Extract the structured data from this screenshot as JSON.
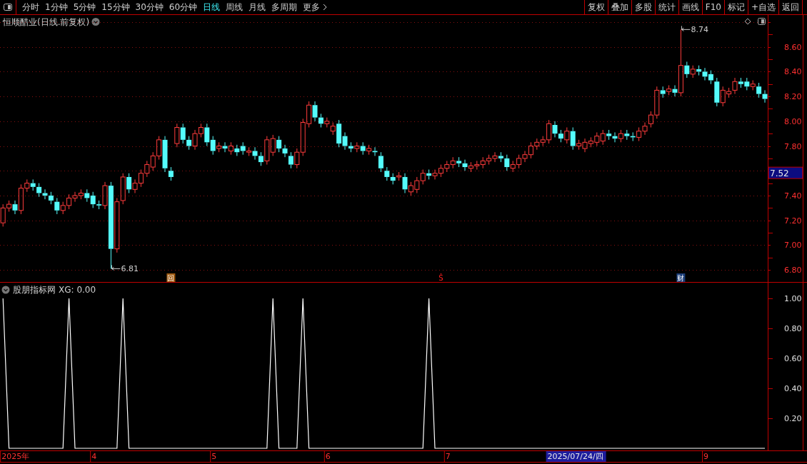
{
  "toolbar": {
    "periods": [
      {
        "label": "分时",
        "selected": false
      },
      {
        "label": "1分钟",
        "selected": false
      },
      {
        "label": "5分钟",
        "selected": false
      },
      {
        "label": "15分钟",
        "selected": false
      },
      {
        "label": "30分钟",
        "selected": false
      },
      {
        "label": "60分钟",
        "selected": false
      },
      {
        "label": "日线",
        "selected": true
      },
      {
        "label": "周线",
        "selected": false
      },
      {
        "label": "月线",
        "selected": false
      },
      {
        "label": "多周期",
        "selected": false
      },
      {
        "label": "更多",
        "selected": false
      }
    ],
    "buttons": [
      "复权",
      "叠加",
      "多股",
      "统计",
      "画线",
      "F10",
      "标记",
      "+自选",
      "返回"
    ]
  },
  "price_panel": {
    "title": "恒顺醋业(日线.前复权)",
    "chart_data": {
      "type": "candlestick",
      "ylim": [
        6.7,
        8.85
      ],
      "yticks": [
        {
          "value": 6.8,
          "label": "6.80"
        },
        {
          "value": 7.0,
          "label": "7.00"
        },
        {
          "value": 7.2,
          "label": "7.20"
        },
        {
          "value": 7.4,
          "label": "7.40"
        },
        {
          "value": 7.8,
          "label": "7.80"
        },
        {
          "value": 8.0,
          "label": "8.00"
        },
        {
          "value": 8.2,
          "label": "8.20"
        },
        {
          "value": 8.4,
          "label": "8.40"
        },
        {
          "value": 8.6,
          "label": "8.60"
        }
      ],
      "categories": [
        null,
        null,
        null,
        null,
        null,
        null,
        null,
        null,
        null,
        null,
        null,
        null,
        null,
        null,
        null,
        null,
        null,
        null,
        null,
        null,
        null,
        null,
        null,
        null,
        null,
        null,
        null,
        null,
        null,
        null,
        null,
        null,
        null,
        null,
        null,
        null,
        null,
        null,
        null,
        null,
        null,
        null,
        null,
        null,
        null,
        null,
        null,
        null,
        null,
        null,
        null,
        null,
        null,
        null,
        null,
        null,
        null,
        null,
        null,
        null,
        null,
        null,
        null,
        null,
        null,
        null,
        null,
        null,
        null,
        null,
        null,
        null,
        null,
        null,
        null,
        null,
        null,
        null,
        null,
        null,
        null,
        null,
        null,
        null,
        null,
        null,
        null,
        null,
        null,
        null,
        null,
        null,
        null,
        null,
        null,
        null,
        null,
        null,
        null,
        null,
        null,
        null,
        null,
        null,
        null,
        null,
        null,
        null,
        null,
        null,
        null,
        null,
        null,
        null,
        null,
        null,
        null,
        null,
        null,
        null,
        null,
        null,
        null,
        null,
        null,
        null,
        null,
        null
      ],
      "ohlc": [
        [
          7.18,
          7.33,
          7.15,
          7.3
        ],
        [
          7.3,
          7.36,
          7.27,
          7.33
        ],
        [
          7.33,
          7.36,
          7.25,
          7.28
        ],
        [
          7.28,
          7.49,
          7.25,
          7.46
        ],
        [
          7.46,
          7.53,
          7.43,
          7.5
        ],
        [
          7.5,
          7.53,
          7.44,
          7.47
        ],
        [
          7.47,
          7.5,
          7.39,
          7.42
        ],
        [
          7.42,
          7.45,
          7.37,
          7.4
        ],
        [
          7.4,
          7.43,
          7.33,
          7.36
        ],
        [
          7.35,
          7.38,
          7.25,
          7.28
        ],
        [
          7.28,
          7.35,
          7.25,
          7.32
        ],
        [
          7.32,
          7.41,
          7.29,
          7.38
        ],
        [
          7.38,
          7.43,
          7.35,
          7.4
        ],
        [
          7.4,
          7.45,
          7.37,
          7.42
        ],
        [
          7.42,
          7.45,
          7.35,
          7.38
        ],
        [
          7.4,
          7.43,
          7.3,
          7.33
        ],
        [
          7.33,
          7.36,
          7.29,
          7.32
        ],
        [
          7.32,
          7.51,
          7.29,
          7.48
        ],
        [
          7.48,
          7.51,
          6.81,
          6.97
        ],
        [
          6.97,
          7.38,
          6.94,
          7.35
        ],
        [
          7.36,
          7.58,
          7.33,
          7.55
        ],
        [
          7.55,
          7.58,
          7.42,
          7.45
        ],
        [
          7.45,
          7.53,
          7.42,
          7.5
        ],
        [
          7.5,
          7.61,
          7.47,
          7.58
        ],
        [
          7.58,
          7.68,
          7.55,
          7.65
        ],
        [
          7.63,
          7.75,
          7.6,
          7.72
        ],
        [
          7.72,
          7.88,
          7.69,
          7.85
        ],
        [
          7.85,
          7.88,
          7.59,
          7.62
        ],
        [
          7.6,
          7.63,
          7.52,
          7.55
        ],
        [
          7.82,
          7.98,
          7.79,
          7.95
        ],
        [
          7.95,
          7.98,
          7.82,
          7.85
        ],
        [
          7.85,
          7.88,
          7.77,
          7.8
        ],
        [
          7.8,
          7.93,
          7.77,
          7.9
        ],
        [
          7.9,
          7.98,
          7.87,
          7.95
        ],
        [
          7.95,
          7.98,
          7.8,
          7.83
        ],
        [
          7.85,
          7.88,
          7.73,
          7.76
        ],
        [
          7.78,
          7.83,
          7.75,
          7.8
        ],
        [
          7.8,
          7.83,
          7.75,
          7.78
        ],
        [
          7.76,
          7.83,
          7.73,
          7.8
        ],
        [
          7.78,
          7.81,
          7.72,
          7.75
        ],
        [
          7.8,
          7.83,
          7.73,
          7.76
        ],
        [
          7.75,
          7.79,
          7.72,
          7.76
        ],
        [
          7.76,
          7.79,
          7.69,
          7.72
        ],
        [
          7.72,
          7.75,
          7.64,
          7.67
        ],
        [
          7.68,
          7.88,
          7.65,
          7.85
        ],
        [
          7.75,
          7.89,
          7.72,
          7.86
        ],
        [
          7.85,
          7.88,
          7.75,
          7.78
        ],
        [
          7.78,
          7.81,
          7.71,
          7.74
        ],
        [
          7.72,
          7.75,
          7.62,
          7.65
        ],
        [
          7.65,
          7.78,
          7.62,
          7.75
        ],
        [
          7.75,
          8.02,
          7.72,
          7.99
        ],
        [
          7.98,
          8.16,
          7.95,
          8.13
        ],
        [
          8.13,
          8.16,
          8.0,
          8.03
        ],
        [
          8.03,
          8.06,
          7.95,
          7.98
        ],
        [
          7.98,
          8.03,
          7.95,
          8.0
        ],
        [
          7.92,
          7.99,
          7.89,
          7.96
        ],
        [
          7.98,
          8.01,
          7.79,
          7.82
        ],
        [
          7.88,
          7.91,
          7.77,
          7.8
        ],
        [
          7.8,
          7.83,
          7.75,
          7.78
        ],
        [
          7.78,
          7.83,
          7.75,
          7.8
        ],
        [
          7.8,
          7.83,
          7.73,
          7.76
        ],
        [
          7.76,
          7.81,
          7.73,
          7.78
        ],
        [
          7.76,
          7.79,
          7.72,
          7.75
        ],
        [
          7.72,
          7.75,
          7.59,
          7.62
        ],
        [
          7.6,
          7.63,
          7.52,
          7.55
        ],
        [
          7.55,
          7.58,
          7.49,
          7.52
        ],
        [
          7.55,
          7.59,
          7.52,
          7.56
        ],
        [
          7.55,
          7.58,
          7.42,
          7.45
        ],
        [
          7.43,
          7.51,
          7.4,
          7.48
        ],
        [
          7.45,
          7.55,
          7.42,
          7.52
        ],
        [
          7.52,
          7.61,
          7.49,
          7.58
        ],
        [
          7.58,
          7.61,
          7.53,
          7.56
        ],
        [
          7.56,
          7.61,
          7.53,
          7.58
        ],
        [
          7.58,
          7.65,
          7.55,
          7.62
        ],
        [
          7.62,
          7.68,
          7.59,
          7.65
        ],
        [
          7.65,
          7.71,
          7.62,
          7.68
        ],
        [
          7.68,
          7.71,
          7.63,
          7.66
        ],
        [
          7.66,
          7.69,
          7.6,
          7.63
        ],
        [
          7.62,
          7.67,
          7.59,
          7.64
        ],
        [
          7.64,
          7.68,
          7.61,
          7.65
        ],
        [
          7.65,
          7.71,
          7.62,
          7.68
        ],
        [
          7.68,
          7.73,
          7.65,
          7.7
        ],
        [
          7.7,
          7.75,
          7.67,
          7.72
        ],
        [
          7.72,
          7.75,
          7.67,
          7.7
        ],
        [
          7.7,
          7.73,
          7.6,
          7.63
        ],
        [
          7.62,
          7.68,
          7.59,
          7.65
        ],
        [
          7.65,
          7.73,
          7.62,
          7.7
        ],
        [
          7.7,
          7.76,
          7.67,
          7.73
        ],
        [
          7.73,
          7.83,
          7.7,
          7.8
        ],
        [
          7.8,
          7.86,
          7.77,
          7.83
        ],
        [
          7.83,
          7.88,
          7.8,
          7.85
        ],
        [
          7.85,
          8.01,
          7.82,
          7.98
        ],
        [
          7.97,
          8.0,
          7.87,
          7.9
        ],
        [
          7.9,
          7.93,
          7.83,
          7.86
        ],
        [
          7.85,
          7.95,
          7.82,
          7.92
        ],
        [
          7.92,
          7.95,
          7.77,
          7.8
        ],
        [
          7.8,
          7.85,
          7.77,
          7.82
        ],
        [
          7.78,
          7.86,
          7.75,
          7.83
        ],
        [
          7.82,
          7.87,
          7.79,
          7.84
        ],
        [
          7.83,
          7.91,
          7.8,
          7.88
        ],
        [
          7.84,
          7.93,
          7.81,
          7.9
        ],
        [
          7.9,
          7.93,
          7.85,
          7.88
        ],
        [
          7.88,
          7.91,
          7.83,
          7.86
        ],
        [
          7.86,
          7.93,
          7.83,
          7.9
        ],
        [
          7.9,
          7.93,
          7.85,
          7.88
        ],
        [
          7.88,
          7.91,
          7.84,
          7.87
        ],
        [
          7.87,
          7.95,
          7.84,
          7.92
        ],
        [
          7.92,
          7.99,
          7.89,
          7.96
        ],
        [
          7.98,
          8.08,
          7.95,
          8.05
        ],
        [
          8.05,
          8.28,
          8.02,
          8.25
        ],
        [
          8.25,
          8.28,
          8.19,
          8.22
        ],
        [
          8.24,
          8.29,
          8.21,
          8.26
        ],
        [
          8.26,
          8.29,
          8.2,
          8.23
        ],
        [
          8.23,
          8.74,
          8.2,
          8.45
        ],
        [
          8.45,
          8.48,
          8.35,
          8.38
        ],
        [
          8.38,
          8.45,
          8.35,
          8.42
        ],
        [
          8.42,
          8.45,
          8.37,
          8.4
        ],
        [
          8.4,
          8.43,
          8.33,
          8.36
        ],
        [
          8.38,
          8.41,
          8.3,
          8.33
        ],
        [
          8.32,
          8.35,
          8.12,
          8.15
        ],
        [
          8.15,
          8.28,
          8.12,
          8.25
        ],
        [
          8.22,
          8.27,
          8.19,
          8.24
        ],
        [
          8.25,
          8.35,
          8.22,
          8.32
        ],
        [
          8.32,
          8.35,
          8.27,
          8.3
        ],
        [
          8.32,
          8.35,
          8.25,
          8.28
        ],
        [
          8.28,
          8.33,
          8.25,
          8.3
        ],
        [
          8.28,
          8.31,
          8.19,
          8.22
        ],
        [
          8.22,
          8.25,
          8.15,
          8.18
        ]
      ],
      "grid": true,
      "annotations": [
        "6.81",
        "8.74"
      ]
    },
    "event_marks": [
      {
        "kind": "boxed",
        "label": "回"
      },
      {
        "kind": "plain",
        "label": "Ŝ"
      },
      {
        "kind": "filled",
        "label": "财"
      }
    ],
    "cursor": {
      "price_label": "7.52",
      "date_label": "2025/07/24/四"
    }
  },
  "time_axis": {
    "labels": [
      "2025年",
      "4",
      "5",
      "6",
      "7",
      "9"
    ]
  },
  "indicator_panel": {
    "title": "股朋指标网",
    "reading": "XG: 0.00",
    "chart_data": {
      "type": "line",
      "ylim": [
        0,
        1.1
      ],
      "yticks": [
        {
          "value": 0.2,
          "label": "0.20"
        },
        {
          "value": 0.4,
          "label": "0.40"
        },
        {
          "value": 0.6,
          "label": "0.60"
        },
        {
          "value": 0.8,
          "label": "0.80"
        },
        {
          "value": 1.0,
          "label": "1.00"
        }
      ],
      "categories": [
        null,
        null,
        null,
        null,
        null,
        null,
        null,
        null,
        null,
        null,
        null,
        null,
        null,
        null,
        null,
        null,
        null,
        null,
        null,
        null,
        null,
        null,
        null,
        null,
        null,
        null,
        null,
        null,
        null,
        null,
        null,
        null,
        null,
        null,
        null,
        null,
        null,
        null,
        null,
        null,
        null,
        null,
        null,
        null,
        null,
        null,
        null,
        null,
        null,
        null,
        null,
        null,
        null,
        null,
        null,
        null,
        null,
        null,
        null,
        null,
        null,
        null,
        null,
        null,
        null,
        null,
        null,
        null,
        null,
        null,
        null,
        null,
        null,
        null,
        null,
        null,
        null,
        null,
        null,
        null,
        null,
        null,
        null,
        null,
        null,
        null,
        null,
        null,
        null,
        null,
        null,
        null,
        null,
        null,
        null,
        null,
        null,
        null,
        null,
        null,
        null,
        null,
        null,
        null,
        null,
        null,
        null,
        null,
        null,
        null,
        null,
        null,
        null,
        null,
        null,
        null,
        null,
        null,
        null,
        null,
        null,
        null,
        null,
        null,
        null,
        null,
        null,
        null
      ],
      "values": [
        1,
        0,
        0,
        0,
        0,
        0,
        0,
        0,
        0,
        0,
        0,
        1,
        0,
        0,
        0,
        0,
        0,
        0,
        0,
        0,
        1,
        0,
        0,
        0,
        0,
        0,
        0,
        0,
        0,
        0,
        0,
        0,
        0,
        0,
        0,
        0,
        0,
        0,
        0,
        0,
        0,
        0,
        0,
        0,
        0,
        1,
        0,
        0,
        0,
        0,
        1,
        0,
        0,
        0,
        0,
        0,
        0,
        0,
        0,
        0,
        0,
        0,
        0,
        0,
        0,
        0,
        0,
        0,
        0,
        0,
        0,
        1,
        0,
        0,
        0,
        0,
        0,
        0,
        0,
        0,
        0,
        0,
        0,
        0,
        0,
        0,
        0,
        0,
        0,
        0,
        0,
        0,
        0,
        0,
        0,
        0,
        0,
        0,
        0,
        0,
        0,
        0,
        0,
        0,
        0,
        0,
        0,
        0,
        0,
        0,
        0,
        0,
        0,
        0,
        0,
        0,
        0,
        0,
        0,
        0,
        0,
        0,
        0,
        0,
        0,
        0,
        0,
        0
      ]
    }
  }
}
